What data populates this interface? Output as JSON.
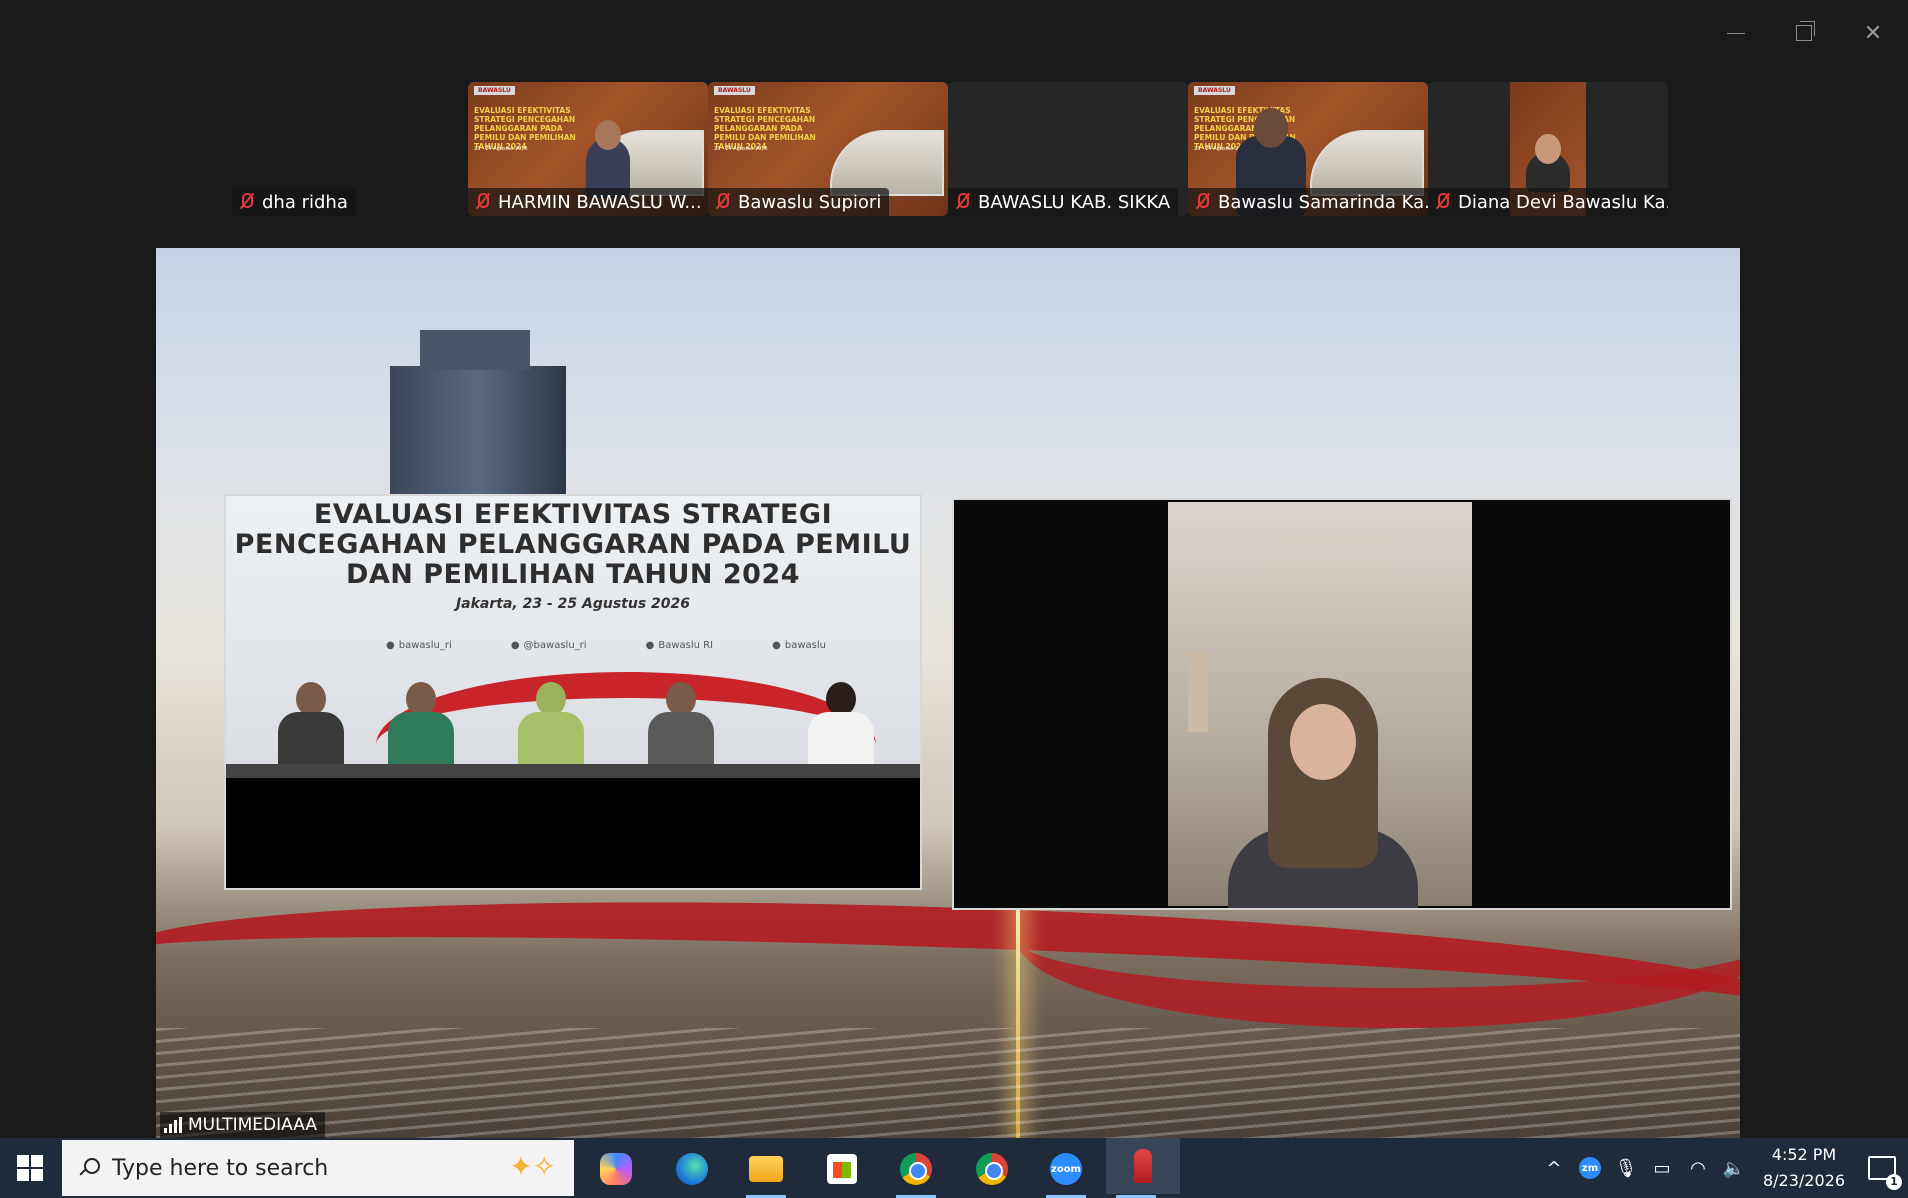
{
  "participants": [
    {
      "name": "dha ridha",
      "muted": true
    },
    {
      "name": "HARMIN BAWASLU W...",
      "muted": true
    },
    {
      "name": "Bawaslu Supiori",
      "muted": true
    },
    {
      "name": "BAWASLU KAB. SIKKA",
      "muted": true
    },
    {
      "name": "Bawaslu Samarinda Ka...",
      "muted": true
    },
    {
      "name": "Diana Devi Bawaslu Ka...",
      "muted": true
    }
  ],
  "thumbnail_slide": {
    "brand": "BAWASLU",
    "title": "EVALUASI EFEKTIVITAS STRATEGI PENCEGAHAN PELANGGARAN PADA PEMILU DAN PEMILIHAN TAHUN 2024",
    "date": "23 - 24 Agustus 2026"
  },
  "main_share": {
    "presenter_name": "MULTIMEDIAAA",
    "stage_title_line1": "EVALUASI EFEKTIVITAS STRATEGI",
    "stage_title_line2": "PENCEGAHAN PELANGGARAN PADA PEMILU",
    "stage_title_line3": "DAN PEMILIHAN TAHUN 2024",
    "stage_date": "Jakarta, 23 - 25 Agustus 2026",
    "social": [
      "bawaslu_ri",
      "@bawaslu_ri",
      "Bawaslu RI",
      "bawaslu"
    ]
  },
  "taskbar": {
    "search_placeholder": "Type here to search",
    "apps": [
      "copilot-icon",
      "edge-icon",
      "file-explorer-icon",
      "store-icon",
      "chrome-icon",
      "chrome-icon",
      "zoom-icon",
      "pen-app-icon"
    ],
    "tray": {
      "zoom_badge": "zm",
      "time": "4:52 PM",
      "date": "8/23/2026",
      "notifications": "1"
    }
  },
  "colors": {
    "muted_red": "#e23a3a",
    "bawaslu_red": "#b31c22",
    "taskbar": "#1f2a3a"
  }
}
